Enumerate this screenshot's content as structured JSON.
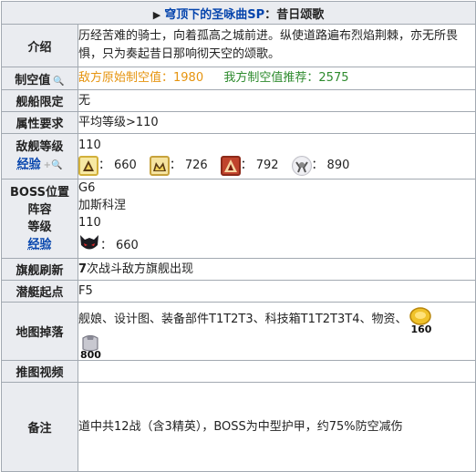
{
  "header": {
    "prefix": "▶",
    "title": "穹顶下的圣咏曲SP",
    "sep": "：",
    "stage": "昔日颂歌"
  },
  "intro": {
    "label": "介绍",
    "text": "历经苦难的骑士，向着孤高之城前进。纵使道路遍布烈焰荆棘，亦无所畏惧，只为奏起昔日那响彻天空的颂歌。"
  },
  "air": {
    "label": "制空值",
    "enemy_label": "敌方原始制空值：",
    "enemy_value": "1980",
    "ally_label": "我方制空值推荐：",
    "ally_value": "2575"
  },
  "ship_limit": {
    "label": "舰船限定",
    "value": "无"
  },
  "attr_req": {
    "label": "属性要求",
    "value": "平均等级>110"
  },
  "enemy_level": {
    "label1": "敌舰等级",
    "label2": "经验",
    "level": "110",
    "exp": [
      {
        "icon": "small-fleet-icon",
        "value": "660"
      },
      {
        "icon": "medium-fleet-icon",
        "value": "726"
      },
      {
        "icon": "large-fleet-icon",
        "value": "792"
      },
      {
        "icon": "boss-ship-icon",
        "value": "890"
      }
    ]
  },
  "boss": {
    "label_pos": "BOSS位置",
    "label_fleet": "阵容",
    "label_level": "等级",
    "label_exp": "经验",
    "position": "G6",
    "fleet": "加斯科涅",
    "level": "110",
    "exp": "660"
  },
  "flag_refresh": {
    "label": "旗舰刷新",
    "count": "7",
    "text": "次战斗敌方旗舰出现"
  },
  "sub_start": {
    "label": "潜艇起点",
    "value": "F5"
  },
  "drops": {
    "label": "地图掉落",
    "text": "舰娘、设计图、装备部件T1T2T3、科技箱T1T2T3T4、物资、",
    "coin": "160",
    "oil": "800"
  },
  "video": {
    "label": "推图视频"
  },
  "notes": {
    "label": "备注",
    "text": "道中共12战（含3精英），BOSS为中型护甲，约75%防空减伤"
  },
  "colors": {
    "header_bg": "#eaecf0",
    "border": "#a2a9b1",
    "link": "#0645ad",
    "orange": "#e6940f",
    "green": "#2e8b2e"
  }
}
